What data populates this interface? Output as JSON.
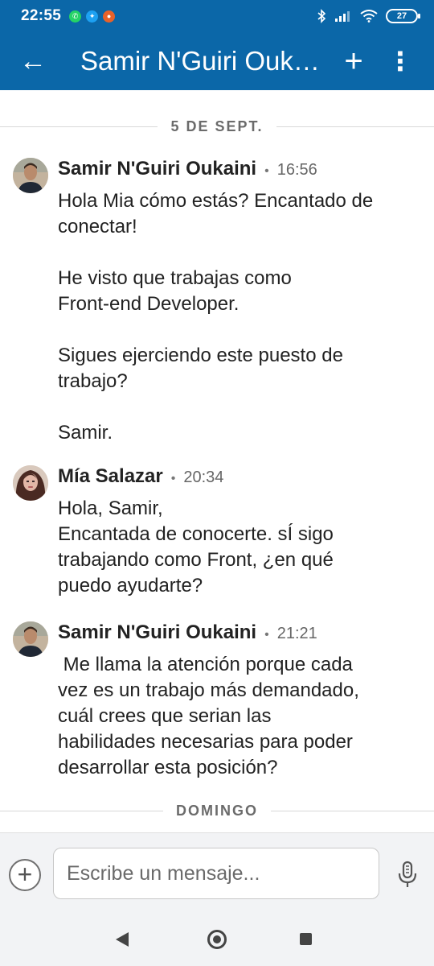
{
  "status_bar": {
    "time": "22:55",
    "battery": "27",
    "notification_icons": [
      "whatsapp-icon",
      "twitter-icon",
      "app-notification-icon"
    ]
  },
  "app_bar": {
    "title": "Samir N'Guiri Oukaini",
    "back_icon": "arrow-left-icon",
    "add_icon": "plus-icon",
    "more_icon": "more-vertical-icon",
    "color": "#0b67a8"
  },
  "date_dividers": [
    "5 DE SEPT.",
    "DOMINGO"
  ],
  "messages": [
    {
      "sender": "Samir N'Guiri Oukaini",
      "separator": "•",
      "time": "16:56",
      "text": "Hola Mia cómo estás? Encantado de\nconectar!\n\nHe visto que trabajas como\nFront-end Developer.\n\nSigues ejerciendo este puesto de\ntrabajo?\n\nSamir."
    },
    {
      "sender": "Mía Salazar",
      "separator": "•",
      "time": "20:34",
      "text": "Hola, Samir,\nEncantada de conocerte. sÍ sigo\ntrabajando como Front, ¿en qué\npuedo ayudarte?"
    },
    {
      "sender": "Samir N'Guiri Oukaini",
      "separator": "•",
      "time": "21:21",
      "text": " Me llama la atención porque cada\nvez es un trabajo más demandado,\ncuál crees que serian las\nhabilidades necesarias para poder\ndesarrollar esta posición?"
    }
  ],
  "composer": {
    "placeholder": "Escribe un mensaje...",
    "add_icon": "plus-circle-icon",
    "mic_icon": "microphone-icon"
  },
  "nav_bar": {
    "back_icon": "nav-back-icon",
    "home_icon": "nav-home-icon",
    "recent_icon": "nav-recent-icon"
  }
}
